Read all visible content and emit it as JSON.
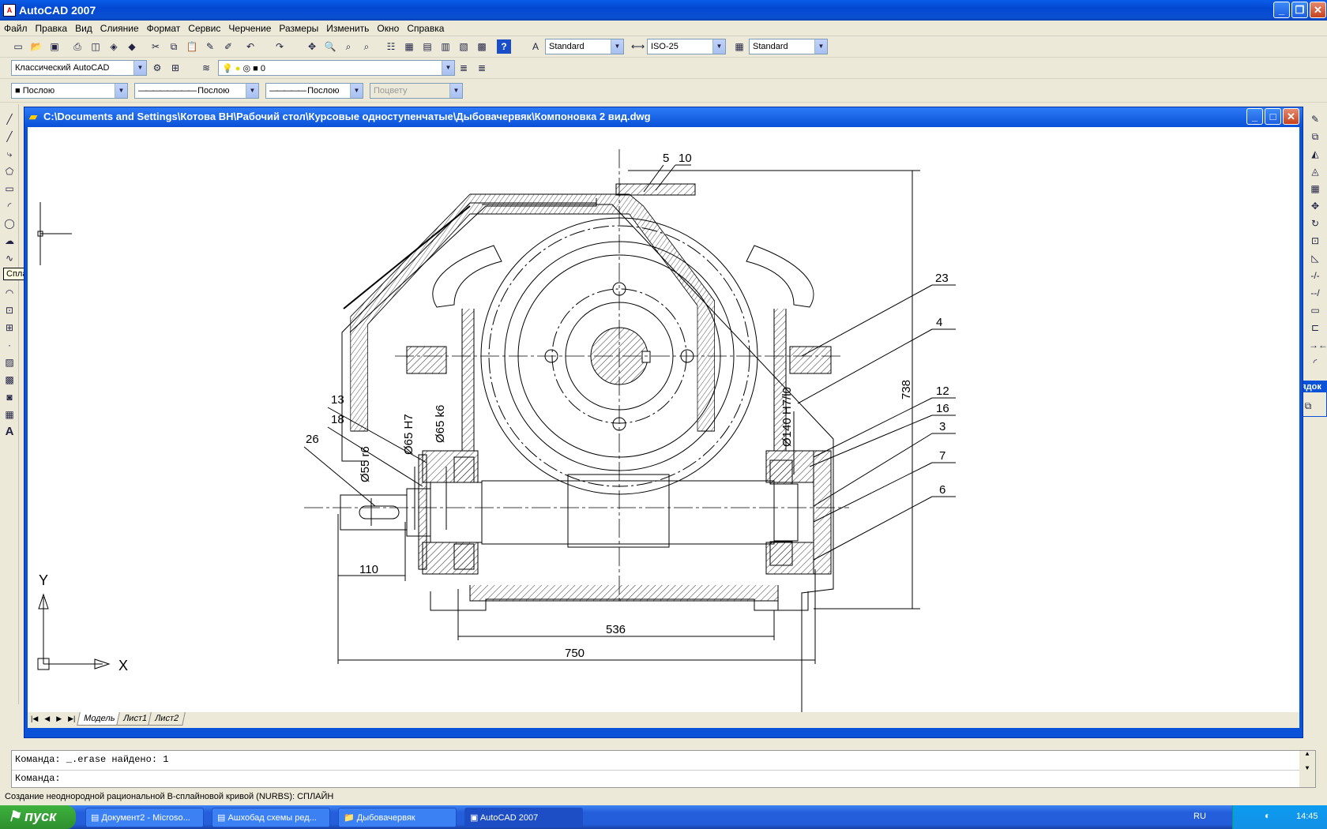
{
  "app": {
    "title": "AutoCAD 2007"
  },
  "menu": [
    "Файл",
    "Правка",
    "Вид",
    "Слияние",
    "Формат",
    "Сервис",
    "Черчение",
    "Размеры",
    "Изменить",
    "Окно",
    "Справка"
  ],
  "styles": {
    "text_style": "Standard",
    "dim_style": "ISO-25",
    "table_style": "Standard"
  },
  "workspace": "Классический AutoCAD",
  "layer": "0",
  "properties": {
    "color": "Послою",
    "linetype": "Послою",
    "lineweight": "Послою",
    "plotstyle": "Поцвету"
  },
  "tooltip": "Сплайн",
  "document": {
    "title": "C:\\Documents and Settings\\Котова ВН\\Рабочий стол\\Курсовые одноступенчатые\\Дыбовачервяк\\Компоновка 2 вид.dwg"
  },
  "drawing": {
    "callouts": [
      "5",
      "10",
      "23",
      "4",
      "12",
      "16",
      "3",
      "7",
      "6",
      "13",
      "18",
      "26"
    ],
    "dims": {
      "d55": "Ø55 r6",
      "d65h": "Ø65 H7",
      "d65k": "Ø65 k6",
      "d140": "Ø140 H7/l0",
      "h738": "738",
      "w110": "110",
      "w536": "536",
      "w750": "750"
    },
    "ucs": {
      "x": "X",
      "y": "Y"
    }
  },
  "tabs": [
    "Модель",
    "Лист1",
    "Лист2"
  ],
  "command": {
    "line1": "Команда: _.erase найдено: 1",
    "line2": "Команда:"
  },
  "status": "Создание неоднородной рациональной B-сплайновой кривой (NURBS): СПЛАЙН",
  "panel": {
    "title": "Порядок"
  },
  "taskbar": {
    "start": "пуск",
    "tasks": [
      "Документ2 - Microso...",
      "Ашхобад схемы ред...",
      "Дыбовачервяк",
      "AutoCAD 2007"
    ],
    "lang": "RU",
    "clock": "14:45"
  }
}
